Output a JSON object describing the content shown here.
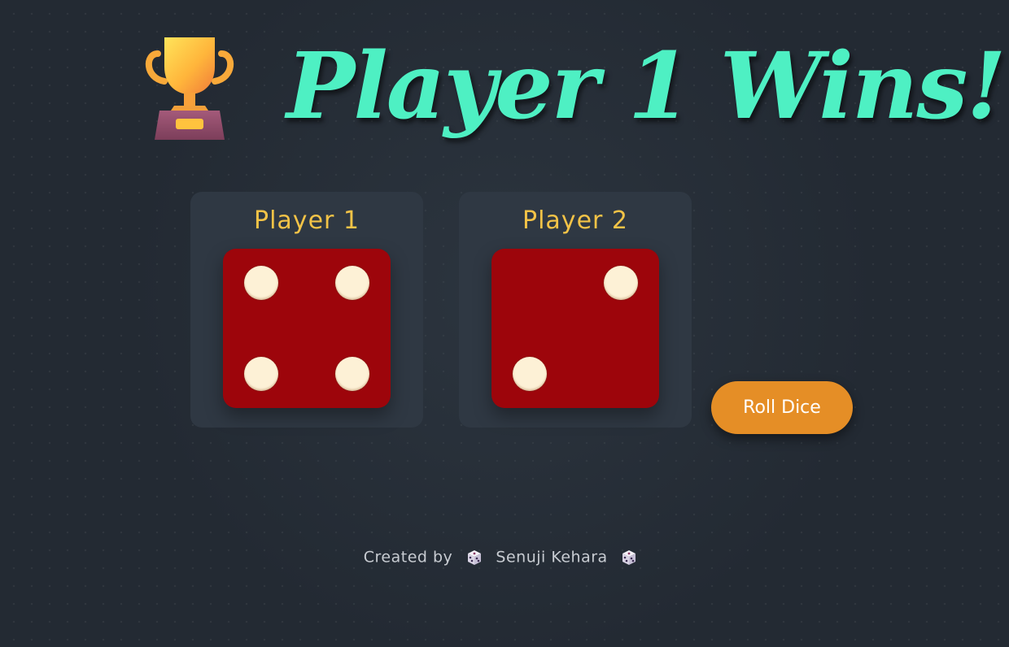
{
  "header": {
    "trophy_icon": "trophy-icon",
    "title": "Player 1 Wins!",
    "title_color": "#4ef0c3"
  },
  "players": [
    {
      "label": "Player 1",
      "die_value": 4
    },
    {
      "label": "Player 2",
      "die_value": 2
    }
  ],
  "controls": {
    "roll_label": "Roll Dice",
    "button_color": "#e58e26"
  },
  "footer": {
    "prefix": "Created by",
    "author": "Senuji Kehara",
    "icon": "game-die-icon"
  },
  "colors": {
    "background": "#232a33",
    "card": "#2f3843",
    "die_face": "#9d050b",
    "pip": "#fdf1d6",
    "player_label": "#f3c347"
  }
}
